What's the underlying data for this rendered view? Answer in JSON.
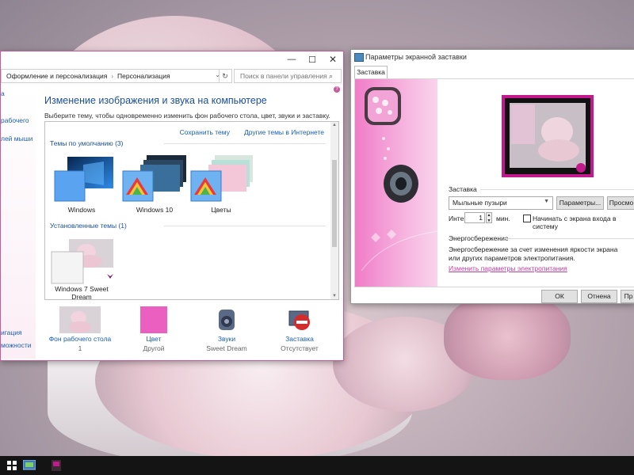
{
  "personalization": {
    "address": {
      "crumb1": "Оформление и персонализация",
      "separator": "›",
      "crumb2": "Персонализация",
      "dropdown": "⌄",
      "refresh": "↻"
    },
    "search": {
      "placeholder": "Поиск в панели управления",
      "icon": "⌕"
    },
    "caption": {
      "minimize": "—",
      "maximize": "☐",
      "close": "✕"
    },
    "left_nav": [
      "а",
      "рабочего",
      "лей мыши",
      "игация",
      "можности"
    ],
    "title": "Изменение изображения и звука на компьютере",
    "description": "Выберите тему, чтобы одновременно изменить фон рабочего стола, цвет, звуки и заставку.",
    "links": {
      "save": "Сохранить тему",
      "more": "Другие темы в Интернете"
    },
    "default_group": "Темы по умолчанию (3)",
    "installed_group": "Установленные темы (1)",
    "themes": [
      "Windows",
      "Windows 10",
      "Цветы"
    ],
    "installed_theme": "Windows 7 Sweet Dream",
    "bottom": [
      {
        "name": "Фон рабочего стола",
        "value": "1"
      },
      {
        "name": "Цвет",
        "value": "Другой"
      },
      {
        "name": "Звуки",
        "value": "Sweet Dream"
      },
      {
        "name": "Заставка",
        "value": "Отсутствует"
      }
    ],
    "accent_color": "#c85a9a"
  },
  "screensaver": {
    "title": "Параметры экранной заставки",
    "tab": "Заставка",
    "group_screensaver": "Заставка",
    "selected": "Мыльные пузыри",
    "btn_params": "Параметры...",
    "btn_preview": "Просмо",
    "interval_label": "Интер",
    "interval_value": "1",
    "minutes": "мин.",
    "start_login": "Начинать с экрана входа в систему",
    "group_power": "Энергосбережение",
    "power_text": "Энергосбережение за счет изменения яркости экрана или других параметров электропитания.",
    "power_link": "Изменить параметры электропитания",
    "ok": "ОК",
    "cancel": "Отнена",
    "apply": "Пр"
  },
  "taskbar": {
    "icons": [
      "windows-start-icon",
      "control-panel-icon",
      "screensaver-icon"
    ]
  }
}
